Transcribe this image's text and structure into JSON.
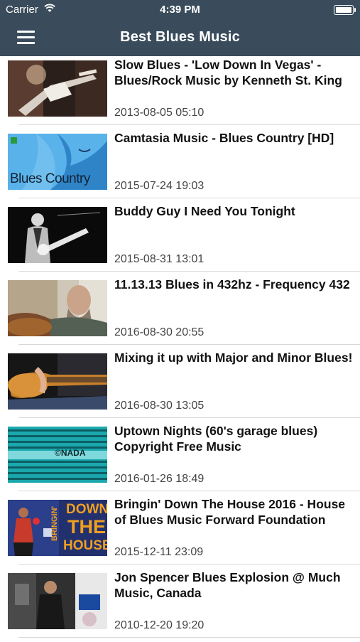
{
  "status_bar": {
    "carrier": "Carrier",
    "time": "4:39 PM",
    "wifi_icon": "wifi-icon",
    "battery_icon": "battery-icon"
  },
  "nav": {
    "title": "Best Blues Music",
    "menu_icon": "hamburger-menu-icon",
    "background": "#3a4c5b"
  },
  "videos": [
    {
      "title": "Slow Blues - 'Low Down In Vegas' - Blues/Rock Music by  Kenneth St. King",
      "date": "2013-08-05 05:10"
    },
    {
      "title": "Camtasia Music - Blues Country [HD]",
      "date": "2015-07-24 19:03",
      "thumb_text": "Blues Country"
    },
    {
      "title": "Buddy Guy   I Need You Tonight",
      "date": "2015-08-31 13:01"
    },
    {
      "title": "11.13.13 Blues in 432hz - Frequency 432",
      "date": "2016-08-30 20:55"
    },
    {
      "title": "Mixing it up with Major and Minor Blues!",
      "date": "2016-08-30 13:05"
    },
    {
      "title": "Uptown Nights (60's garage blues) Copyright Free Music",
      "date": "2016-01-26 18:49",
      "thumb_text": "©NADA"
    },
    {
      "title": "Bringin' Down The House 2016 - House of Blues Music Forward Foundation",
      "date": "2015-12-11 23:09",
      "thumb_text": [
        "BRINGIN'",
        "DOWN",
        "THE",
        "HOUSE"
      ]
    },
    {
      "title": "Jon Spencer Blues Explosion @ Much Music, Canada",
      "date": "2010-12-20 19:20"
    }
  ]
}
